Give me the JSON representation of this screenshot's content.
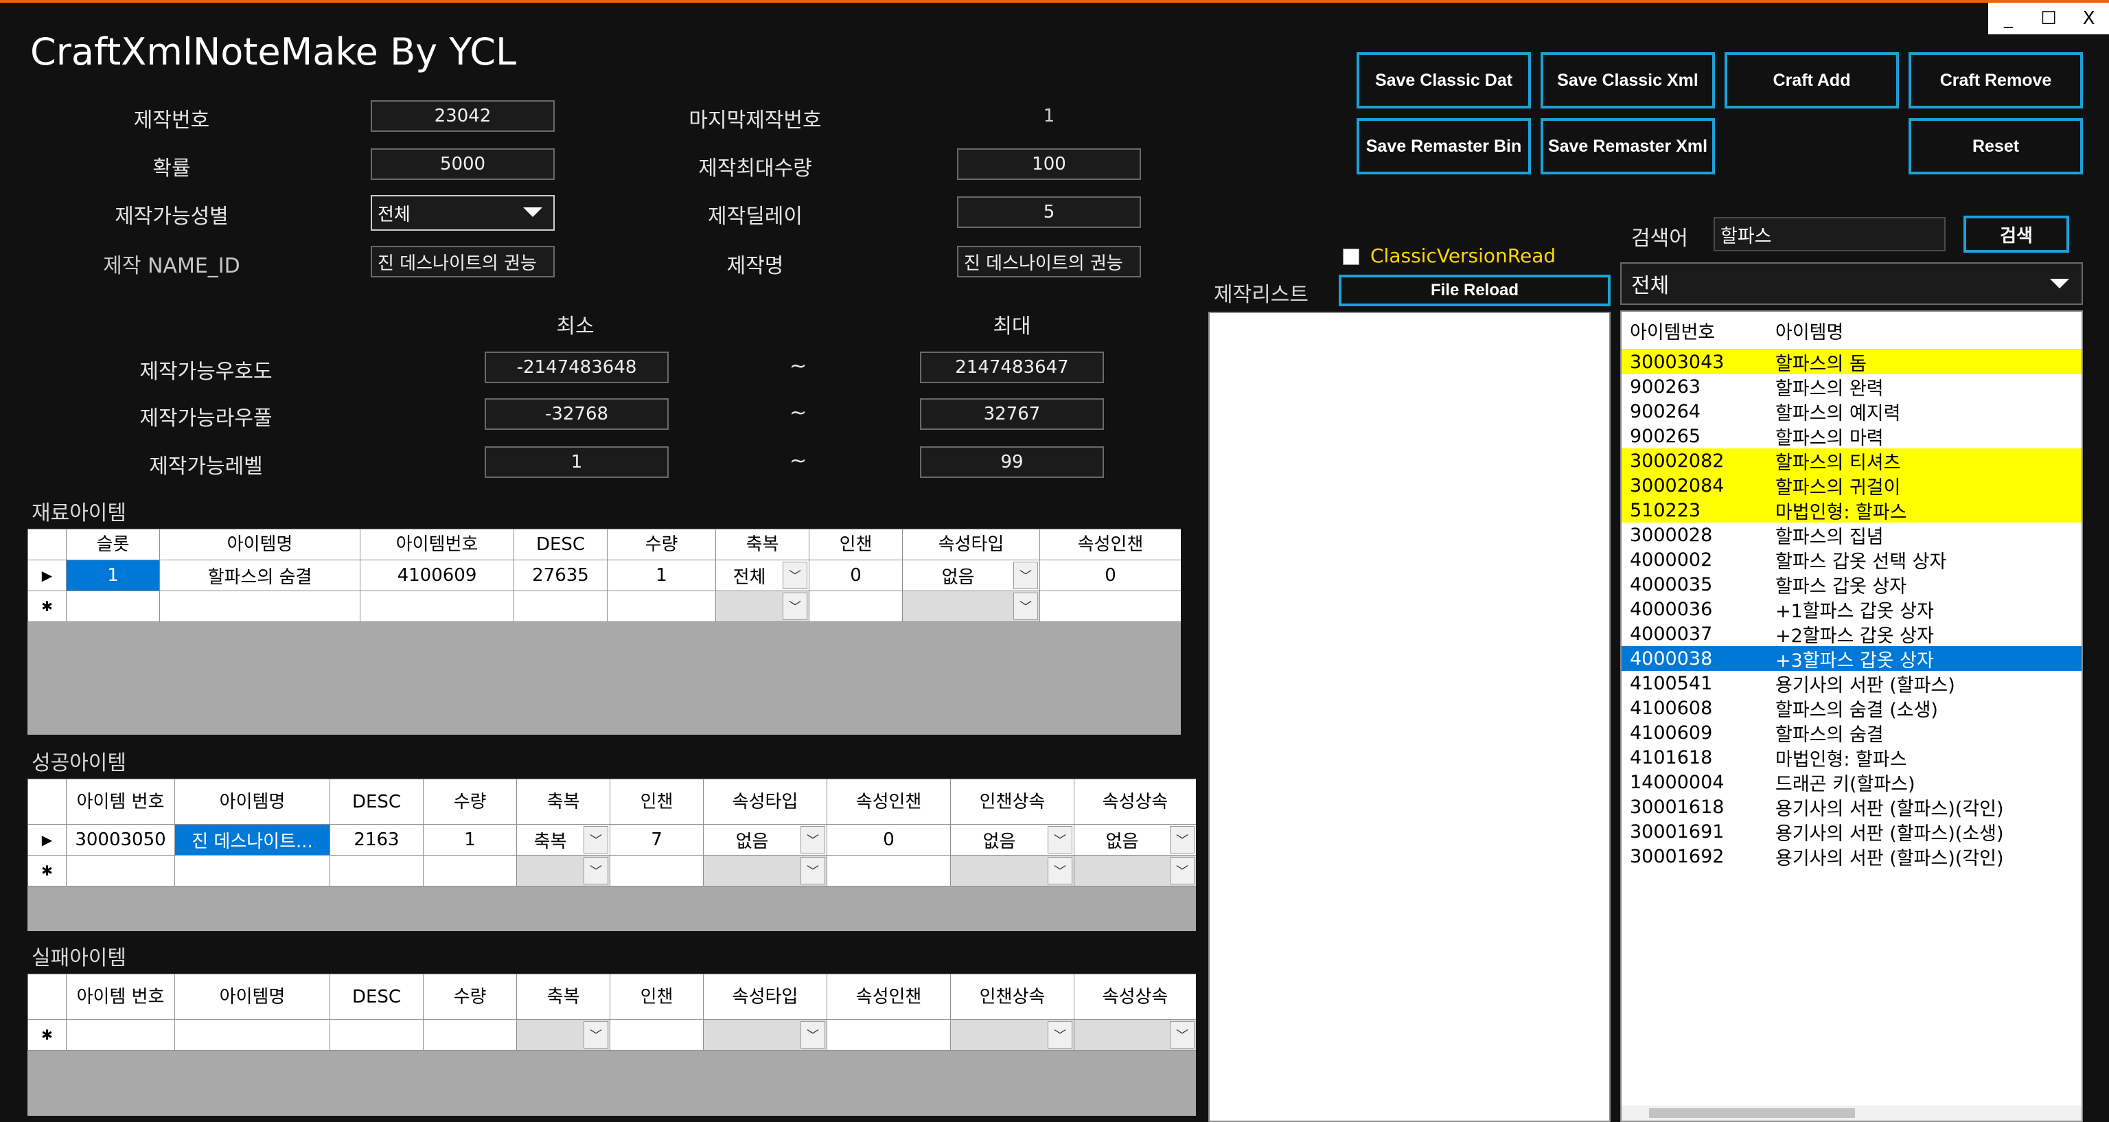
{
  "app": {
    "title": "CraftXmlNoteMake By YCL",
    "window_controls": {
      "minimize": "_",
      "maximize": "☐",
      "close": "X"
    }
  },
  "form": {
    "craft_no": {
      "label": "제작번호",
      "value": "23042"
    },
    "last_craft_no": {
      "label": "마지막제작번호",
      "value": "1"
    },
    "probability": {
      "label": "확률",
      "value": "5000"
    },
    "max_craft_qty": {
      "label": "제작최대수량",
      "value": "100"
    },
    "gender": {
      "label": "제작가능성별",
      "value": "전체"
    },
    "delay": {
      "label": "제작딜레이",
      "value": "5"
    },
    "name_id": {
      "label": "제작 NAME_ID",
      "value": "진 데스나이트의 권능"
    },
    "craft_name": {
      "label": "제작명",
      "value": "진 데스나이트의 권능"
    },
    "min_label": "최소",
    "max_label": "최대",
    "range_sep": "~",
    "ranges": [
      {
        "label": "제작가능우호도",
        "min": "-2147483648",
        "max": "2147483647"
      },
      {
        "label": "제작가능라우풀",
        "min": "-32768",
        "max": "32767"
      },
      {
        "label": "제작가능레벨",
        "min": "1",
        "max": "99"
      }
    ]
  },
  "buttons": {
    "save_classic_dat": "Save Classic Dat",
    "save_classic_xml": "Save Classic Xml",
    "craft_add": "Craft Add",
    "craft_remove": "Craft Remove",
    "save_remaster_bin": "Save Remaster Bin",
    "save_remaster_xml": "Save Remaster Xml",
    "reset": "Reset",
    "file_reload": "File Reload",
    "search": "검색"
  },
  "classic_version_read": {
    "label": "ClassicVersionRead",
    "checked": false
  },
  "craft_list": {
    "label": "제작리스트"
  },
  "search": {
    "label": "검색어",
    "value": "할파스",
    "filter": "전체"
  },
  "materials": {
    "title": "재료아이템",
    "columns": [
      "슬롯",
      "아이템명",
      "아이템번호",
      "DESC",
      "수량",
      "축복",
      "인챈",
      "속성타입",
      "속성인챈"
    ],
    "rows": [
      {
        "slot": "1",
        "name": "할파스의 숨결",
        "item_no": "4100609",
        "desc": "27635",
        "qty": "1",
        "bless": "전체",
        "enchant": "0",
        "attr_type": "없음",
        "attr_enchant": "0"
      }
    ]
  },
  "success": {
    "title": "성공아이템",
    "columns": [
      "아이템 번호",
      "아이템명",
      "DESC",
      "수량",
      "축복",
      "인챈",
      "속성타입",
      "속성인챈",
      "인챈상속",
      "속성상속"
    ],
    "rows": [
      {
        "item_no": "30003050",
        "name": "진 데스나이트...",
        "desc": "2163",
        "qty": "1",
        "bless": "축복",
        "enchant": "7",
        "attr_type": "없음",
        "attr_enchant": "0",
        "enchant_inherit": "없음",
        "attr_inherit": "없음"
      }
    ]
  },
  "failure": {
    "title": "실패아이템",
    "columns": [
      "아이템 번호",
      "아이템명",
      "DESC",
      "수량",
      "축복",
      "인챈",
      "속성타입",
      "속성인챈",
      "인챈상속",
      "속성상속"
    ]
  },
  "results": {
    "columns": [
      "아이템번호",
      "아이템명"
    ],
    "rows": [
      {
        "no": "30003043",
        "name": "할파스의 돔",
        "state": "highlight"
      },
      {
        "no": "900263",
        "name": "할파스의 완력",
        "state": ""
      },
      {
        "no": "900264",
        "name": "할파스의 예지력",
        "state": ""
      },
      {
        "no": "900265",
        "name": "할파스의 마력",
        "state": ""
      },
      {
        "no": "30002082",
        "name": "할파스의 티셔츠",
        "state": "highlight"
      },
      {
        "no": "30002084",
        "name": "할파스의 귀걸이",
        "state": "highlight"
      },
      {
        "no": "510223",
        "name": "마법인형: 할파스",
        "state": "highlight"
      },
      {
        "no": "3000028",
        "name": "할파스의 집념",
        "state": ""
      },
      {
        "no": "4000002",
        "name": "할파스 갑옷 선택 상자",
        "state": ""
      },
      {
        "no": "4000035",
        "name": "할파스 갑옷 상자",
        "state": ""
      },
      {
        "no": "4000036",
        "name": "+1할파스 갑옷 상자",
        "state": ""
      },
      {
        "no": "4000037",
        "name": "+2할파스 갑옷 상자",
        "state": ""
      },
      {
        "no": "4000038",
        "name": "+3할파스 갑옷 상자",
        "state": "selected"
      },
      {
        "no": "4100541",
        "name": "용기사의 서판 (할파스)",
        "state": ""
      },
      {
        "no": "4100608",
        "name": "할파스의 숨결 (소생)",
        "state": ""
      },
      {
        "no": "4100609",
        "name": "할파스의 숨결",
        "state": ""
      },
      {
        "no": "4101618",
        "name": "마법인형: 할파스",
        "state": ""
      },
      {
        "no": "14000004",
        "name": "드래곤 키(할파스)",
        "state": ""
      },
      {
        "no": "30001618",
        "name": "용기사의 서판 (할파스)(각인)",
        "state": ""
      },
      {
        "no": "30001691",
        "name": "용기사의 서판 (할파스)(소생)",
        "state": ""
      },
      {
        "no": "30001692",
        "name": "용기사의 서판 (할파스)(각인)",
        "state": ""
      }
    ]
  },
  "colors": {
    "accent": "#1ea0d6",
    "topbar": "#e8660c",
    "highlight": "#ffff00",
    "selection": "#0078d7",
    "classic_label": "#ffd700"
  }
}
